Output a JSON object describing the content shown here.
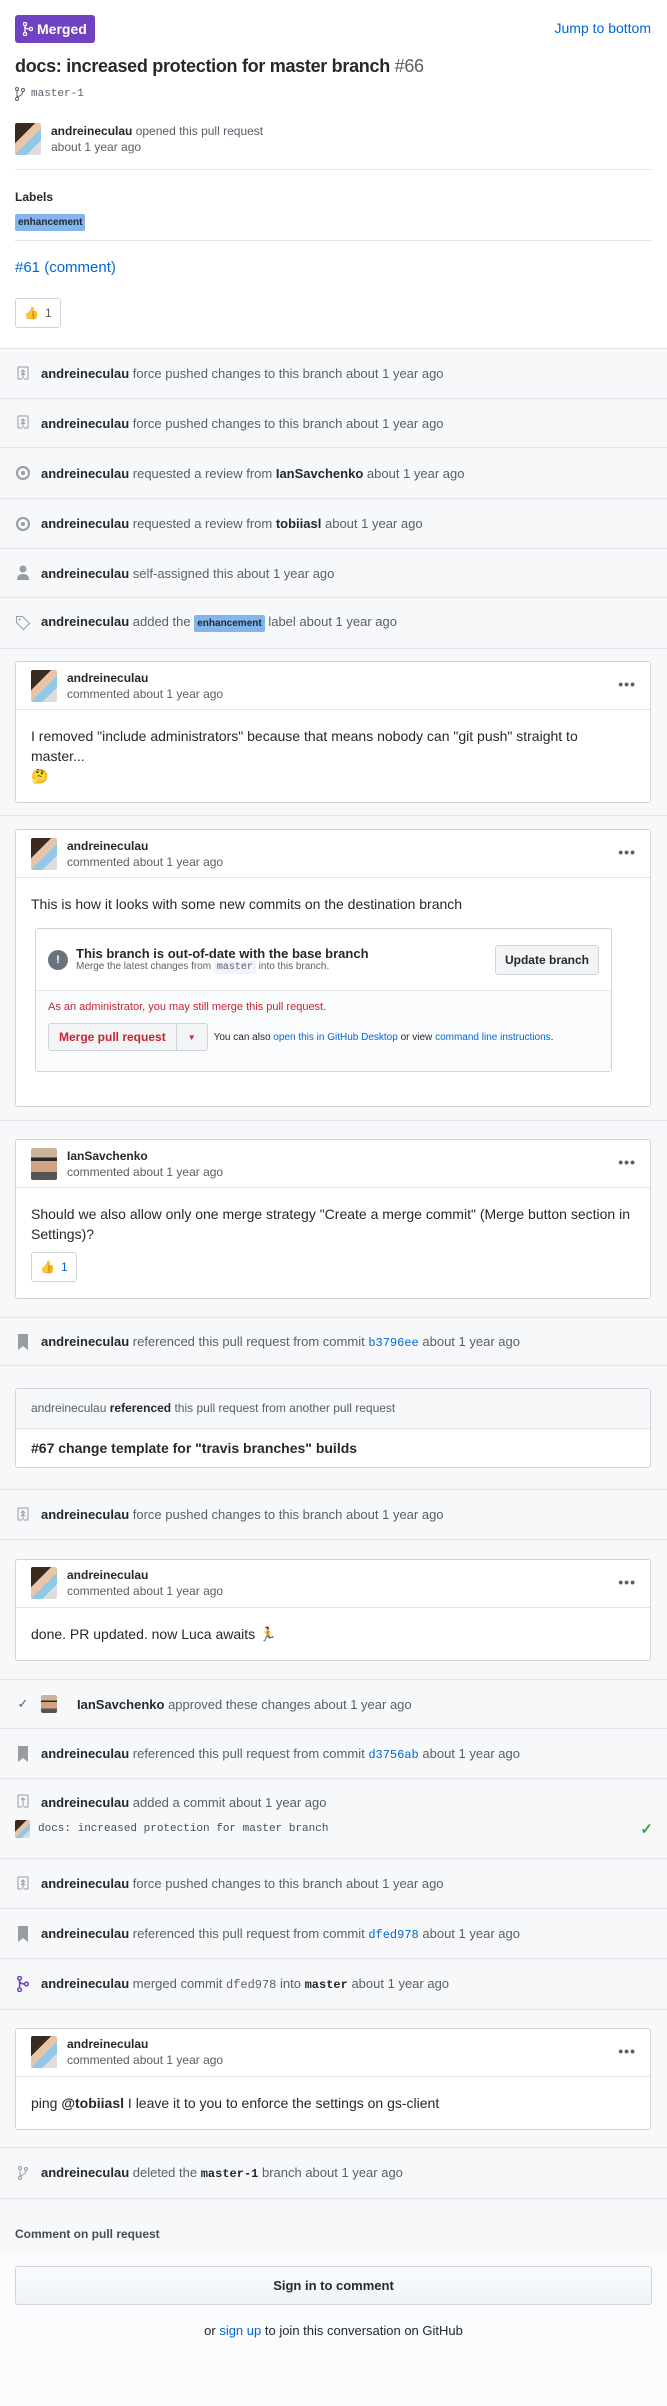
{
  "header": {
    "state": "Merged",
    "jump": "Jump to bottom",
    "title": "docs: increased protection for master branch",
    "number": "#66",
    "branch": "master-1",
    "author": "andreineculau",
    "opened": "opened this pull request",
    "time": "about 1 year ago",
    "labels_heading": "Labels",
    "label": "enhancement",
    "body_link": "#61 (comment)",
    "reaction": {
      "emoji": "👍",
      "count": "1"
    }
  },
  "colors": {
    "merged": "#6f42c1",
    "link": "#0366d6",
    "label": "#84b6eb",
    "danger": "#cb2431",
    "success": "#28a745"
  },
  "timeline": {
    "e1": {
      "actor": "andreineculau",
      "text": "force pushed changes to this branch about 1 year ago"
    },
    "e2": {
      "actor": "andreineculau",
      "text": "force pushed changes to this branch about 1 year ago"
    },
    "e3": {
      "actor": "andreineculau",
      "pre": "requested a review from",
      "target": "IanSavchenko",
      "post": "about 1 year ago"
    },
    "e4": {
      "actor": "andreineculau",
      "pre": "requested a review from",
      "target": "tobiiasl",
      "post": "about 1 year ago"
    },
    "e5": {
      "actor": "andreineculau",
      "text": "self-assigned this about 1 year ago"
    },
    "e6": {
      "actor": "andreineculau",
      "pre": "added the",
      "label": "enhancement",
      "post": "label about 1 year ago"
    },
    "c1": {
      "author": "andreineculau",
      "meta": "commented about 1 year ago",
      "body": "I removed \"include administrators\" because that means nobody can \"git push\" straight to master...",
      "emoji": "🤔"
    },
    "c2": {
      "author": "andreineculau",
      "meta": "commented about 1 year ago",
      "body": "This is how it looks with some new commits on the destination branch",
      "merge": {
        "title": "This branch is out-of-date with the base branch",
        "sub_pre": "Merge the latest changes from",
        "sub_code": "master",
        "sub_post": "into this branch.",
        "update": "Update branch",
        "admin": "As an administrator, you may still merge this pull request.",
        "merge_btn": "Merge pull request",
        "also": "You can also",
        "desktop": "open this in GitHub Desktop",
        "or_view": "or view",
        "cli": "command line instructions",
        "dot": "."
      }
    },
    "c3": {
      "author": "IanSavchenko",
      "meta": "commented about 1 year ago",
      "body": "Should we also allow only one merge strategy \"Create a merge commit\" (Merge button section in Settings)?",
      "reaction": {
        "emoji": "👍",
        "count": "1"
      }
    },
    "e7": {
      "actor": "andreineculau",
      "pre": "referenced this pull request from commit",
      "sha": "b3796ee",
      "post": "about 1 year ago"
    },
    "xref": {
      "actor": "andreineculau",
      "verb": "referenced",
      "rest": "this pull request from another pull request",
      "title": "#67 change template for \"travis branches\" builds"
    },
    "e8": {
      "actor": "andreineculau",
      "text": "force pushed changes to this branch about 1 year ago"
    },
    "c4": {
      "author": "andreineculau",
      "meta": "commented about 1 year ago",
      "body": "done. PR updated. now Luca awaits",
      "emoji": "🏃"
    },
    "e9": {
      "actor": "IanSavchenko",
      "text": "approved these changes about 1 year ago"
    },
    "e10": {
      "actor": "andreineculau",
      "pre": "referenced this pull request from commit",
      "sha": "d3756ab",
      "post": "about 1 year ago"
    },
    "e11": {
      "actor": "andreineculau",
      "text": "added a commit about 1 year ago",
      "commit": "docs: increased protection for master branch"
    },
    "e12": {
      "actor": "andreineculau",
      "text": "force pushed changes to this branch about 1 year ago"
    },
    "e13": {
      "actor": "andreineculau",
      "pre": "referenced this pull request from commit",
      "sha": "dfed978",
      "post": "about 1 year ago"
    },
    "e14": {
      "actor": "andreineculau",
      "pre": "merged commit",
      "sha": "dfed978",
      "mid": "into",
      "branch": "master",
      "post": "about 1 year ago"
    },
    "c5": {
      "author": "andreineculau",
      "meta": "commented about 1 year ago",
      "pre": "ping",
      "mention": "@tobiiasl",
      "post": "I leave it to you to enforce the settings on gs-client"
    },
    "e15": {
      "actor": "andreineculau",
      "pre": "deleted the",
      "branch": "master-1",
      "post": "branch about 1 year ago"
    }
  },
  "footer": {
    "heading": "Comment on pull request",
    "signin": "Sign in to comment",
    "or": "or",
    "signup": "sign up",
    "join": "to join this conversation on GitHub"
  }
}
